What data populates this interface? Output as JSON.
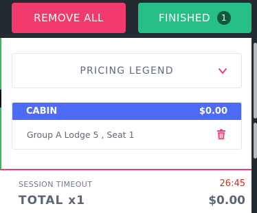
{
  "header": {
    "remove_all_label": "REMOVE ALL",
    "finished_label": "FINISHED",
    "finished_count": "1"
  },
  "legend": {
    "label": "PRICING LEGEND",
    "icon": "chevron-down-icon"
  },
  "cart": {
    "category": "CABIN",
    "category_price": "$0.00",
    "items": [
      {
        "label": "Group A Lodge 5 , Seat 1",
        "icon": "trash-icon"
      }
    ]
  },
  "footer": {
    "session_label": "SESSION TIMEOUT",
    "session_value": "26:45",
    "total_label": "TOTAL x1",
    "total_value": "$0.00"
  },
  "colors": {
    "remove": "#f23a6c",
    "finished": "#25bf87",
    "cart_header": "#4d6bf7",
    "timeout": "#d42a1c"
  }
}
